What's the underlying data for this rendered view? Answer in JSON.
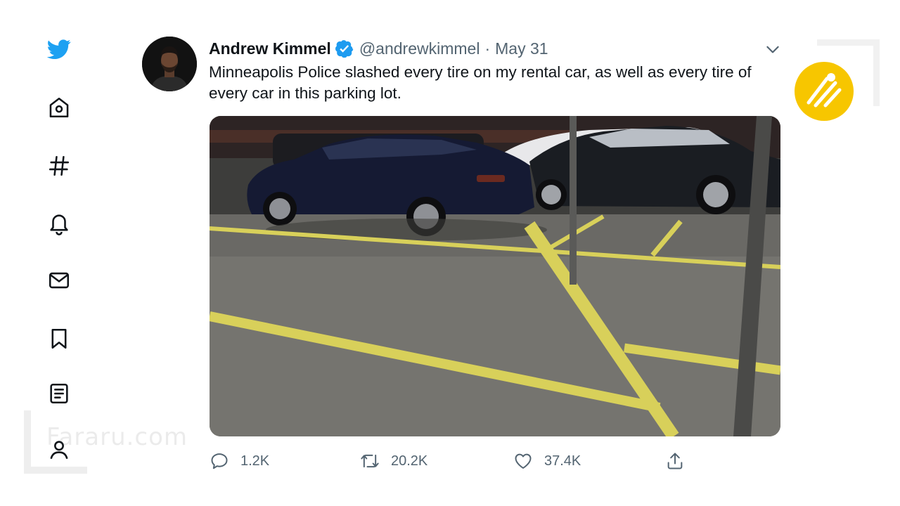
{
  "sidebar": {
    "items": [
      {
        "icon": "twitter-bird-icon"
      },
      {
        "icon": "home-icon"
      },
      {
        "icon": "hashtag-explore-icon"
      },
      {
        "icon": "bell-notifications-icon"
      },
      {
        "icon": "mail-messages-icon"
      },
      {
        "icon": "bookmark-icon"
      },
      {
        "icon": "list-icon"
      },
      {
        "icon": "profile-icon"
      }
    ],
    "accent_color": "#1da1f2"
  },
  "watermark": {
    "text": "Fararu.com"
  },
  "tweet": {
    "author_name": "Andrew Kimmel",
    "handle": "@andrewkimmel",
    "separator": "·",
    "date": "May 31",
    "text": "Minneapolis Police slashed every tire on my rental car, as well as every tire of every car in this parking lot.",
    "verified_color": "#1d9bf0",
    "media": {
      "kind": "video-still",
      "subject": "parked cars in a parking lot at night"
    },
    "actions": {
      "replies": "1.2K",
      "retweets": "20.2K",
      "likes": "37.4K"
    }
  },
  "logo_badge_color": "#f7c600"
}
